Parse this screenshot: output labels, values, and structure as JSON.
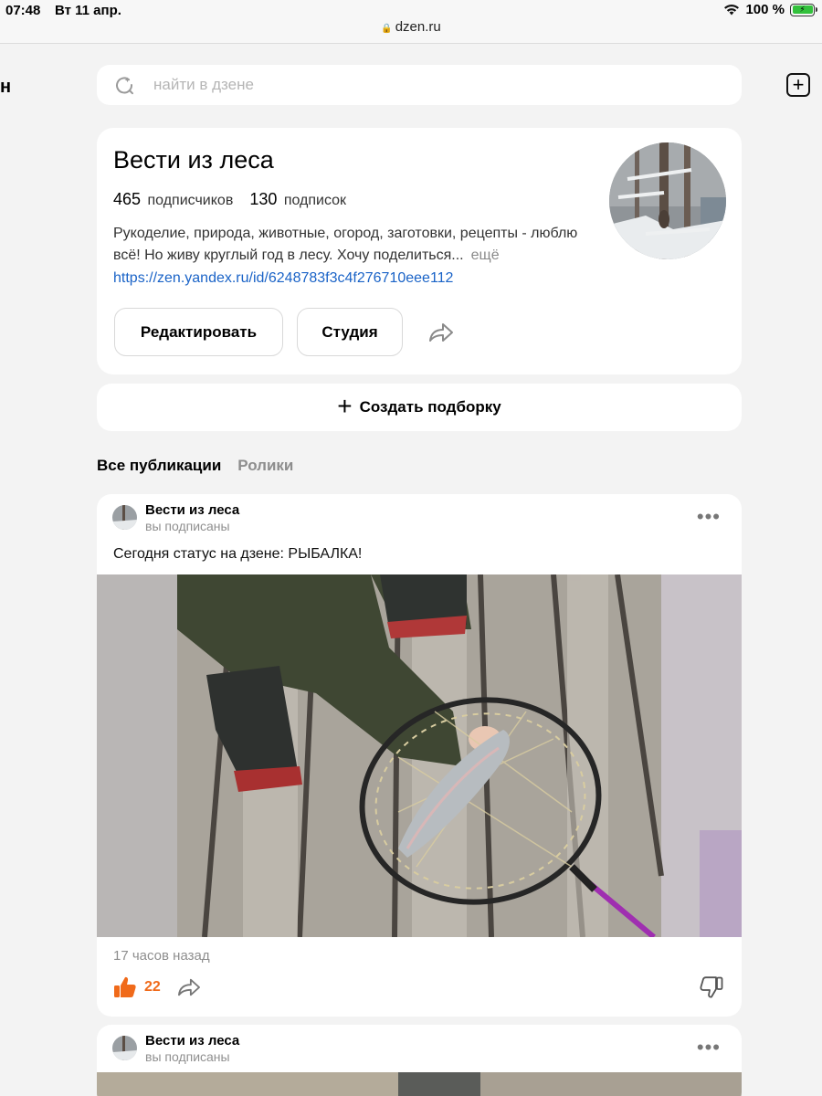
{
  "status_bar": {
    "time": "07:48",
    "date": "Вт 11 апр.",
    "battery": "100 %",
    "url": "dzen.ru"
  },
  "left_edge_text": "н",
  "search": {
    "placeholder": "найти в дзене"
  },
  "profile": {
    "name": "Вести из леса",
    "subscribers_count": "465",
    "subscribers_label": "подписчиков",
    "subscriptions_count": "130",
    "subscriptions_label": "подписок",
    "description": "Рукоделие, природа, животные, огород, заготовки, рецепты - люблю всё! Но живу круглый год в лесу. Хочу поделиться...",
    "more_label": "ещё",
    "link": "https://zen.yandex.ru/id/6248783f3c4f276710eee112",
    "edit_button": "Редактировать",
    "studio_button": "Студия"
  },
  "create_collection": {
    "label": "Создать подборку"
  },
  "tabs": [
    {
      "label": "Все публикации",
      "active": true
    },
    {
      "label": "Ролики",
      "active": false
    }
  ],
  "posts": [
    {
      "author": "Вести из леса",
      "subtitle": "вы подписаны",
      "text": "Сегодня статус на дзене: РЫБАЛКА!",
      "time_ago": "17 часов назад",
      "likes": "22"
    },
    {
      "author": "Вести из леса",
      "subtitle": "вы подписаны"
    }
  ],
  "colors": {
    "background": "#f3f3f3",
    "link": "#1a63c7",
    "like_accent": "#f06a1a",
    "battery": "#33c13c"
  },
  "icons": [
    "lock-icon",
    "wifi-icon",
    "battery-icon",
    "add-square-icon",
    "search-icon",
    "share-icon",
    "plus-icon",
    "more-dots-icon",
    "like-icon",
    "dislike-icon"
  ]
}
